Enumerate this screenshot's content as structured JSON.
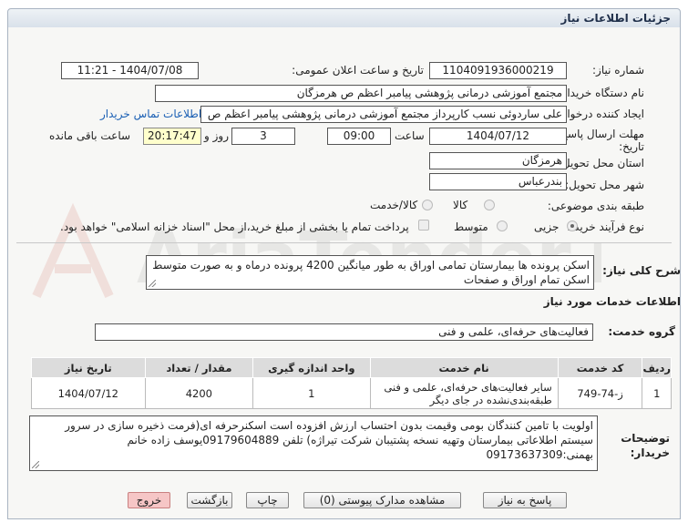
{
  "header": {
    "title": "جزئیات اطلاعات نیاز"
  },
  "need_number": {
    "label": "شماره نیاز:",
    "value": "1104091936000219"
  },
  "announce_datetime": {
    "label": "تاریخ و ساعت اعلان عمومی:",
    "value": "1404/07/08 - 11:21"
  },
  "buyer_org": {
    "label": "نام دستگاه خریدار:",
    "value": "مجتمع آموزشی درمانی پژوهشی پیامبر اعظم ص  هرمزگان"
  },
  "requester": {
    "label": "ایجاد کننده درخواست:",
    "value": "علی ساردوئی نسب کارپرداز مجتمع آموزشی درمانی پژوهشی پیامبر اعظم ص",
    "contact_link": "اطلاعات تماس خریدار"
  },
  "deadline": {
    "label_line1": "مهلت ارسال پاسخ: تا",
    "label_line2": "تاریخ:",
    "date": "1404/07/12",
    "time_label": "ساعت",
    "time": "09:00",
    "days": "3",
    "days_label": "روز و",
    "remaining": "20:17:47",
    "remaining_label": "ساعت باقی مانده"
  },
  "province": {
    "label": "استان محل تحویل:",
    "value": "هرمزگان"
  },
  "city": {
    "label": "شهر محل تحویل:",
    "value": "بندرعباس"
  },
  "category": {
    "label": "طبقه بندی موضوعی:",
    "options": [
      "کالا",
      "کالا/خدمت"
    ],
    "selected": ""
  },
  "purchase_type": {
    "label": "نوع فرآیند خرید :",
    "options": [
      "جزیی",
      "متوسط"
    ],
    "selected": "جزیی",
    "note": "پرداخت تمام یا بخشی از مبلغ خرید،از محل \"اسناد خزانه اسلامی\" خواهد بود."
  },
  "general_desc": {
    "label": "شرح کلی نیاز:",
    "value": "اسکن پرونده ها بیمارستان  تمامی اوراق به طور میانگین 4200 پرونده درماه و به صورت متوسط اسکن تمام اوراق و صفحات"
  },
  "services_title": "اطلاعات خدمات مورد نیاز",
  "service_group": {
    "label": "گروه خدمت:",
    "value": "فعالیت‌های حرفه‌ای، علمی و فنی"
  },
  "table": {
    "headers": [
      "ردیف",
      "کد خدمت",
      "نام خدمت",
      "واحد اندازه گیری",
      "مقدار / تعداد",
      "تاریخ نیاز"
    ],
    "rows": [
      [
        "1",
        "ز-74-749",
        "سایر فعالیت‌های حرفه‌ای، علمی و فنی طبقه‌بندی‌نشده در جای دیگر",
        "1",
        "4200",
        "1404/07/12"
      ]
    ]
  },
  "buyer_notes": {
    "label_line1": "توضیحات",
    "label_line2": "خریدار:",
    "value": "اولویت با تامین  کنندگان   بومی  وقیمت  بدون  احتساب  ارزش افزوده  است اسکنرحرفه ای(فرمت ذخیره سازی در سرور سیستم اطلاعاتی بیمارستان وتهیه نسخه پشتیبان شرکت تیراژه)   تلفن  09179604889یوسف زاده خانم بهمنی:09173637309"
  },
  "buttons": {
    "reply": "پاسخ به نیاز",
    "attachments": "مشاهده مدارک پیوستی (0)",
    "print": "چاپ",
    "back": "بازگشت",
    "exit": "خروج"
  },
  "watermark": "AriaTender.neT"
}
